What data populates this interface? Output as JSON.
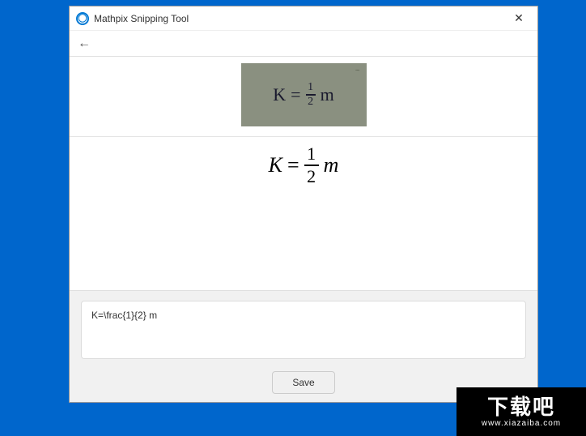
{
  "window": {
    "title": "Mathpix Snipping Tool",
    "close_label": "✕"
  },
  "toolbar": {
    "back_label": "←"
  },
  "handwriting": {
    "K": "K",
    "eq": "=",
    "num": "1",
    "den": "2",
    "m": "m"
  },
  "rendered": {
    "K": "K",
    "eq": "=",
    "num": "1",
    "den": "2",
    "m": "m"
  },
  "latex": {
    "value": "K=\\frac{1}{2} m"
  },
  "buttons": {
    "save": "Save"
  },
  "watermark": {
    "big": "下载吧",
    "small": "www.xiazaiba.com"
  }
}
